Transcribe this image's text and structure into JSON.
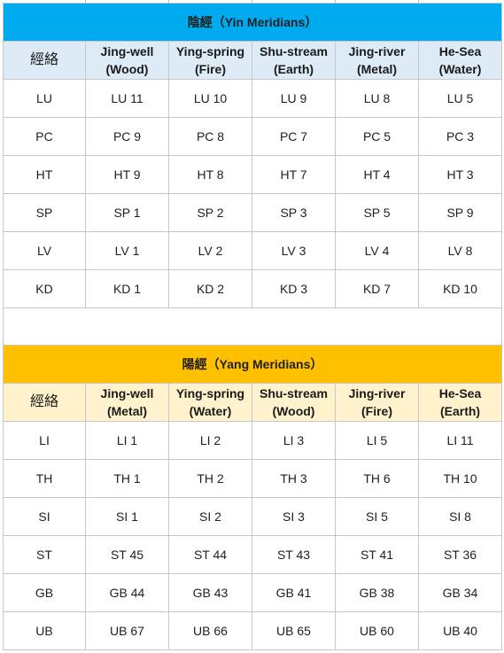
{
  "yin": {
    "title": "陰經（Yin Meridians）",
    "headers": [
      "經絡",
      "Jing-well\n(Wood)",
      "Ying-spring\n(Fire)",
      "Shu-stream\n(Earth)",
      "Jing-river\n(Metal)",
      "He-Sea\n(Water)"
    ],
    "rows": [
      [
        "LU",
        "LU 11",
        "LU 10",
        "LU 9",
        "LU 8",
        "LU 5"
      ],
      [
        "PC",
        "PC 9",
        "PC 8",
        "PC 7",
        "PC 5",
        "PC 3"
      ],
      [
        "HT",
        "HT 9",
        "HT 8",
        "HT 7",
        "HT 4",
        "HT 3"
      ],
      [
        "SP",
        "SP 1",
        "SP 2",
        "SP 3",
        "SP 5",
        "SP 9"
      ],
      [
        "LV",
        "LV 1",
        "LV 2",
        "LV 3",
        "LV 4",
        "LV 8"
      ],
      [
        "KD",
        "KD 1",
        "KD 2",
        "KD 3",
        "KD 7",
        "KD 10"
      ]
    ]
  },
  "yang": {
    "title": "陽經（Yang Meridians）",
    "headers": [
      "經絡",
      "Jing-well\n(Metal)",
      "Ying-spring\n(Water)",
      "Shu-stream\n(Wood)",
      "Jing-river\n(Fire)",
      "He-Sea\n(Earth)"
    ],
    "rows": [
      [
        "LI",
        "LI 1",
        "LI 2",
        "LI 3",
        "LI 5",
        "LI 11"
      ],
      [
        "TH",
        "TH 1",
        "TH 2",
        "TH 3",
        "TH 6",
        "TH 10"
      ],
      [
        "SI",
        "SI 1",
        "SI 2",
        "SI 3",
        "SI 5",
        "SI 8"
      ],
      [
        "ST",
        "ST 45",
        "ST 44",
        "ST 43",
        "ST 41",
        "ST 36"
      ],
      [
        "GB",
        "GB 44",
        "GB 43",
        "GB 41",
        "GB 38",
        "GB 34"
      ],
      [
        "UB",
        "UB 67",
        "UB 66",
        "UB 65",
        "UB 60",
        "UB 40"
      ]
    ]
  },
  "colors": {
    "yin_title_bg": "#00aaee",
    "yin_header_bg": "#ddebf7",
    "yang_title_bg": "#ffc000",
    "yang_header_bg": "#fff2cc",
    "grid_line": "#c7c7c7"
  }
}
